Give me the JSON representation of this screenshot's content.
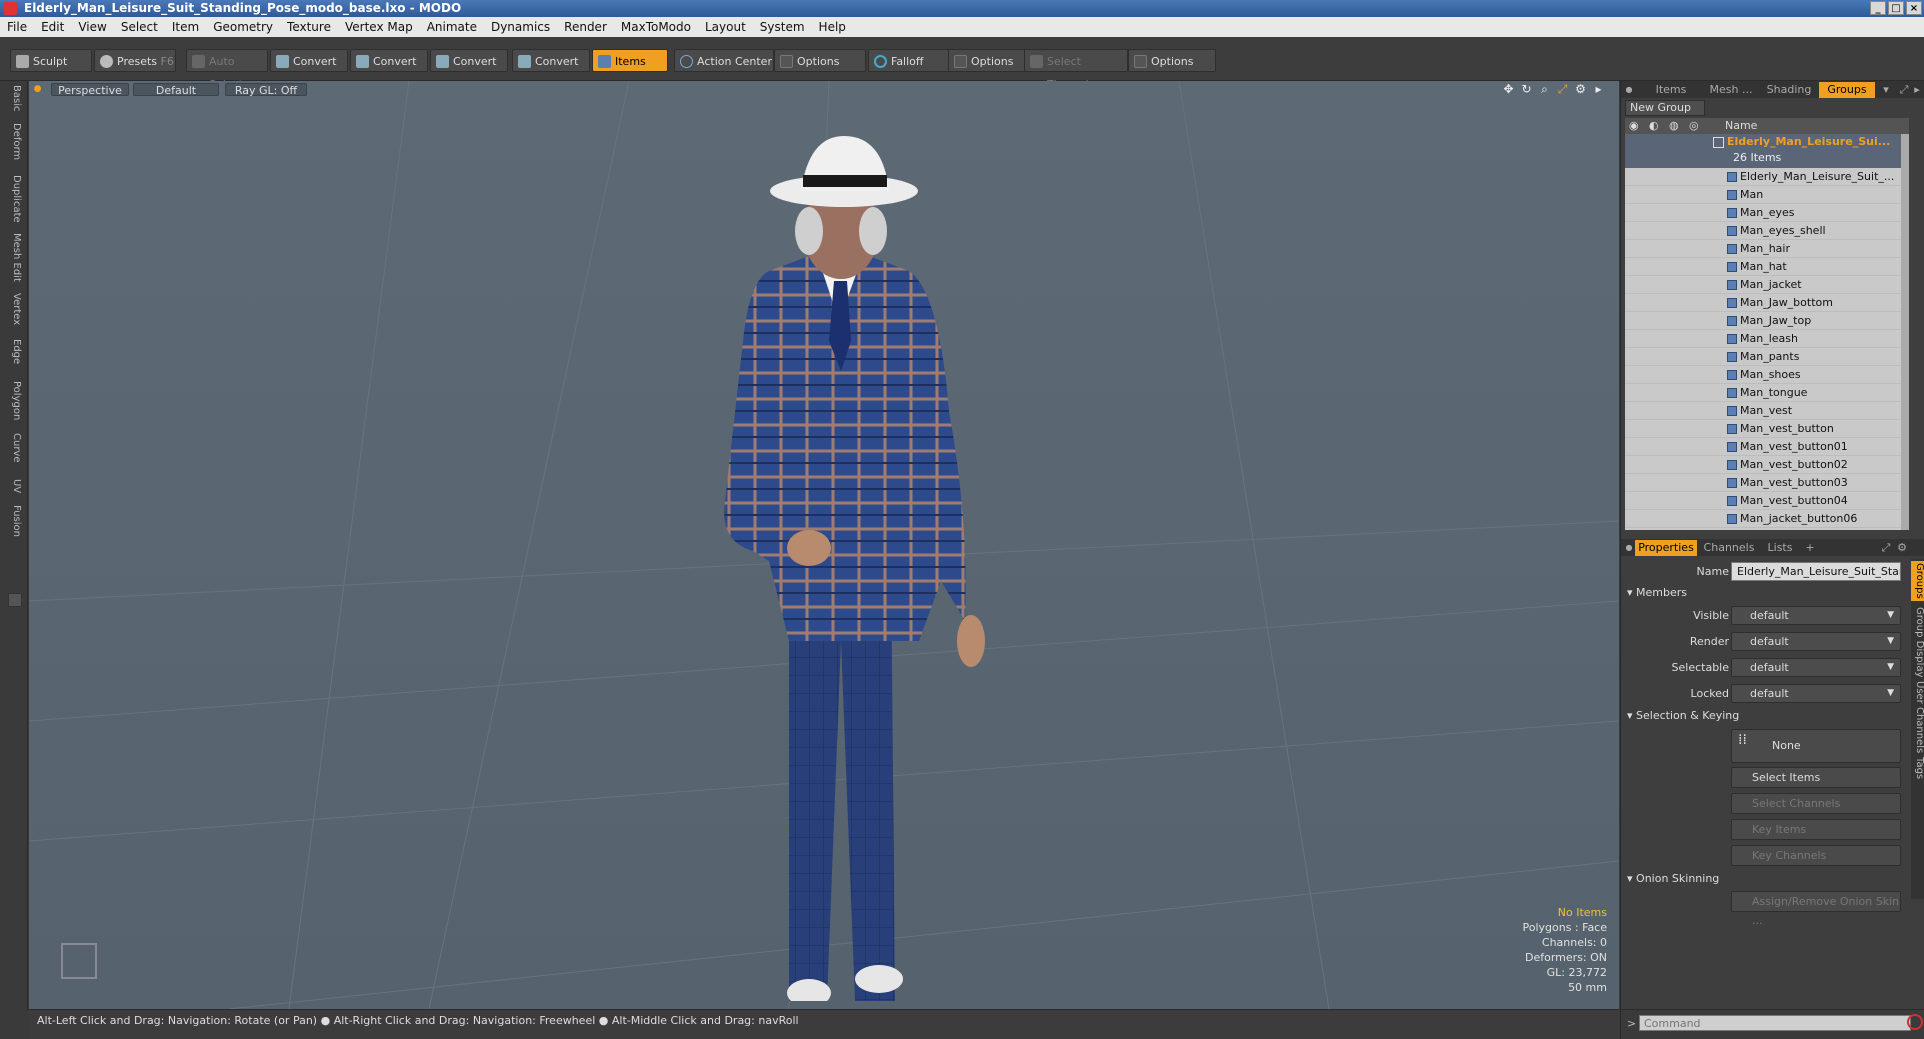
{
  "title": "Elderly_Man_Leisure_Suit_Standing_Pose_modo_base.lxo - MODO",
  "menu": [
    "File",
    "Edit",
    "View",
    "Select",
    "Item",
    "Geometry",
    "Texture",
    "Vertex Map",
    "Animate",
    "Dynamics",
    "Render",
    "MaxToModo",
    "Layout",
    "System",
    "Help"
  ],
  "toolbar": {
    "sculpt": "Sculpt",
    "presets": "Presets",
    "presets_key": "F6",
    "auto_select": "Auto Select",
    "convert1": "Convert",
    "convert2": "Convert",
    "convert3": "Convert",
    "convert4": "Convert",
    "items": "Items",
    "action_center": "Action Center",
    "options1": "Options",
    "falloff": "Falloff",
    "options2": "Options",
    "select_through": "Select Through",
    "options3": "Options"
  },
  "left_tabs": [
    "Basic",
    "Deform",
    "Duplicate",
    "Mesh Edit",
    "Vertex",
    "Edge",
    "Polygon",
    "Curve",
    "UV",
    "Fusion"
  ],
  "viewport": {
    "view": "Perspective",
    "shading": "Default",
    "raygl": "Ray GL: Off"
  },
  "stats": {
    "items": "No Items",
    "polygons": "Polygons : Face",
    "channels": "Channels: 0",
    "deformers": "Deformers: ON",
    "gl": "GL: 23,772",
    "size": "50 mm"
  },
  "status": "Alt-Left Click and Drag: Navigation: Rotate (or Pan) ● Alt-Right Click and Drag: Navigation: Freewheel ● Alt-Middle Click and Drag: navRoll",
  "panel_tabs": [
    "Items",
    "Mesh ...",
    "Shading",
    "Groups"
  ],
  "new_group": "New Group",
  "tree_header": "Name",
  "group": {
    "name": "Elderly_Man_Leisure_Sui...",
    "count": "26 Items",
    "children": [
      "Elderly_Man_Leisure_Suit_...",
      "Man",
      "Man_eyes",
      "Man_eyes_shell",
      "Man_hair",
      "Man_hat",
      "Man_jacket",
      "Man_Jaw_bottom",
      "Man_Jaw_top",
      "Man_leash",
      "Man_pants",
      "Man_shoes",
      "Man_tongue",
      "Man_vest",
      "Man_vest_button",
      "Man_vest_button01",
      "Man_vest_button02",
      "Man_vest_button03",
      "Man_vest_button04",
      "Man_jacket_button06"
    ]
  },
  "prop_tabs": [
    "Properties",
    "Channels",
    "Lists"
  ],
  "props": {
    "name_label": "Name",
    "name_value": "Elderly_Man_Leisure_Suit_Stand",
    "members": "Members",
    "visible_label": "Visible",
    "render_label": "Render",
    "selectable_label": "Selectable",
    "locked_label": "Locked",
    "default": "default",
    "sel_keying": "Selection & Keying",
    "none": "None",
    "select_items": "Select Items",
    "select_channels": "Select Channels",
    "key_items": "Key Items",
    "key_channels": "Key Channels",
    "onion": "Onion Skinning",
    "assign_onion": "Assign/Remove Onion Skin ..."
  },
  "right_vtabs": [
    "Groups",
    "Group Display",
    "User Channels",
    "Tags"
  ],
  "command_placeholder": "Command",
  "colors": {
    "accent": "#f0a020",
    "viewport": "#5a6671"
  }
}
